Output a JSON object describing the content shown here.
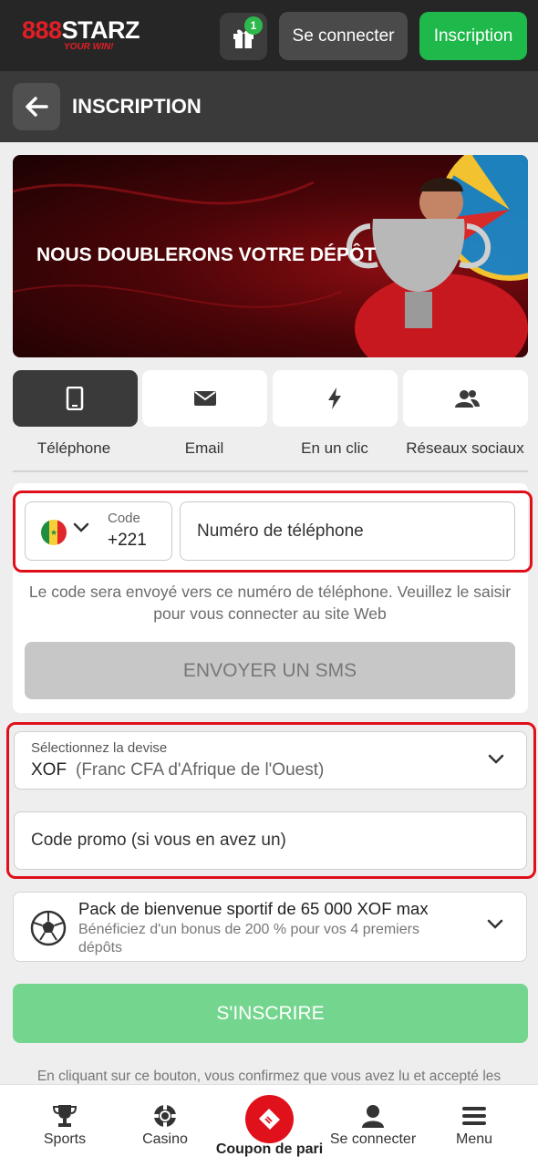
{
  "header": {
    "logo_main": "STARZ",
    "logo_prefix": "888",
    "logo_tagline": "YOUR WIN!",
    "gift_badge": "1",
    "login_label": "Se connecter",
    "register_label": "Inscription"
  },
  "titlebar": {
    "title": "INSCRIPTION"
  },
  "banner": {
    "headline": "NOUS DOUBLERONS VOTRE DÉPÔT"
  },
  "tabs": [
    {
      "label": "Téléphone",
      "icon": "phone-icon",
      "active": true
    },
    {
      "label": "Email",
      "icon": "envelope-icon",
      "active": false
    },
    {
      "label": "En un clic",
      "icon": "lightning-icon",
      "active": false
    },
    {
      "label": "Réseaux sociaux",
      "icon": "users-icon",
      "active": false
    }
  ],
  "phone": {
    "code_label": "Code",
    "code_value": "+221",
    "country_flag": "senegal-flag",
    "number_placeholder": "Numéro de téléphone",
    "hint": "Le code sera envoyé vers ce numéro de téléphone. Veuillez le saisir pour vous connecter au site Web",
    "send_sms_label": "ENVOYER UN SMS"
  },
  "currency": {
    "label": "Sélectionnez la devise",
    "code": "XOF",
    "name": "(Franc CFA d'Afrique de l'Ouest)"
  },
  "promo": {
    "placeholder": "Code promo (si vous en avez un)"
  },
  "bonus": {
    "title": "Pack de bienvenue sportif de 65 000 XOF max",
    "description": "Bénéficiez d'un bonus de 200 % pour vos 4 premiers dépôts"
  },
  "signup_label": "S'INSCRIRE",
  "terms_text": "En cliquant sur ce bouton, vous confirmez que vous avez lu et accepté les",
  "bottom_nav": {
    "sports": "Sports",
    "casino": "Casino",
    "coupon": "Coupon de pari",
    "login": "Se connecter",
    "menu": "Menu"
  },
  "colors": {
    "accent_red": "#e0111b",
    "brand_green": "#1fb84a",
    "signup_green_disabled": "#74d68e",
    "header_dark": "#262626"
  }
}
